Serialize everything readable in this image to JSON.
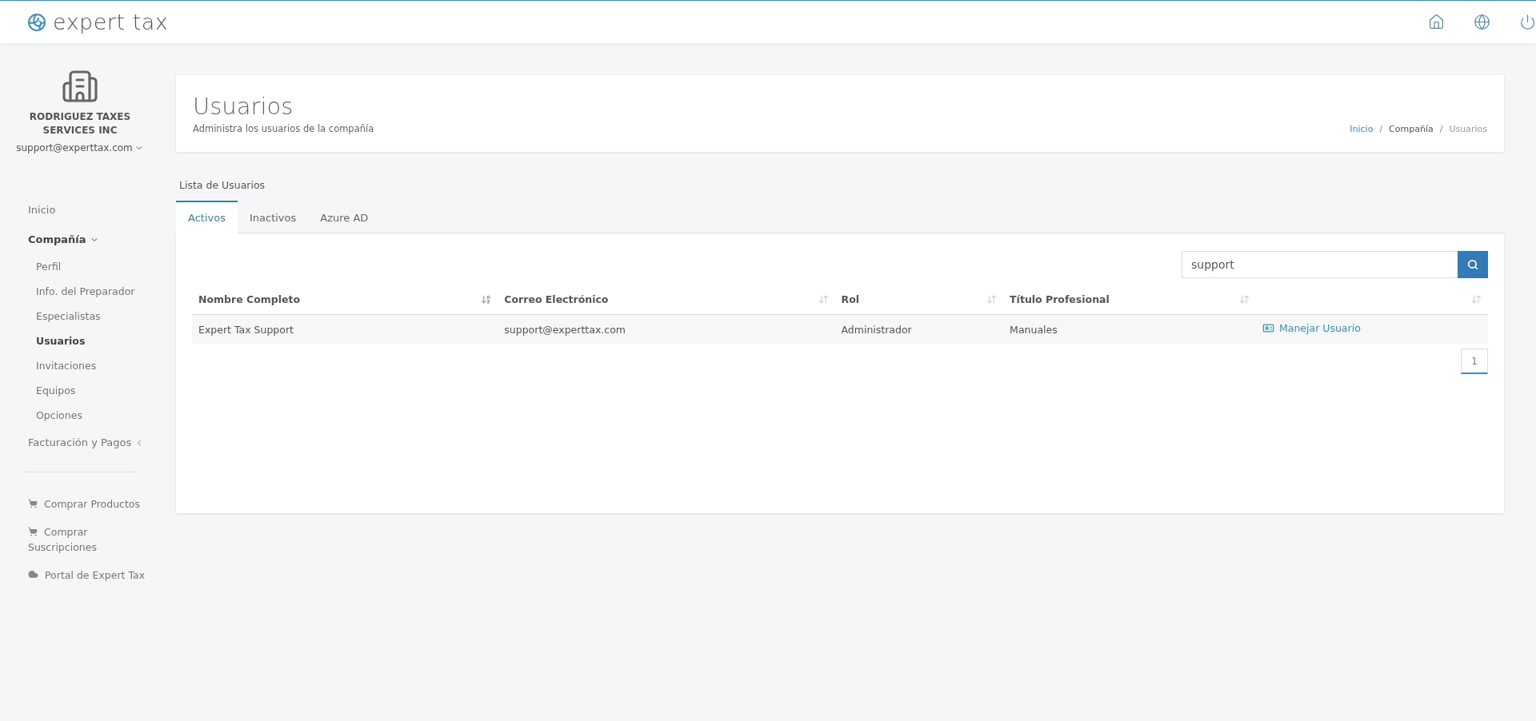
{
  "brand": {
    "name": "expert tax"
  },
  "company": {
    "name": "RODRIGUEZ TAXES SERVICES INC",
    "email": "support@experttax.com"
  },
  "sidebar": {
    "items": [
      {
        "kind": "link",
        "label": "Inicio",
        "selected": false
      },
      {
        "kind": "group",
        "label": "Compañía",
        "selected": false,
        "expanded": true,
        "children": [
          {
            "label": "Perfil",
            "selected": false
          },
          {
            "label": "Info. del Preparador",
            "selected": false
          },
          {
            "label": "Especialistas",
            "selected": false
          },
          {
            "label": "Usuarios",
            "selected": true
          },
          {
            "label": "Invitaciones",
            "selected": false
          },
          {
            "label": "Equipos",
            "selected": false
          },
          {
            "label": "Opciones",
            "selected": false
          }
        ]
      },
      {
        "kind": "group",
        "label": "Facturación y Pagos",
        "selected": false,
        "expanded": false
      }
    ],
    "links": [
      {
        "kind": "cart",
        "label": "Comprar Productos"
      },
      {
        "kind": "cart",
        "label": "Comprar Suscripciones"
      },
      {
        "kind": "cloud",
        "label": "Portal de Expert Tax"
      }
    ]
  },
  "page": {
    "title": "Usuarios",
    "subtitle": "Administra los usuarios de la compañía",
    "breadcrumb": [
      {
        "label": "Inicio",
        "kind": "link"
      },
      {
        "separator": "/",
        "label": "Compañía",
        "kind": "text"
      },
      {
        "separator": "/",
        "label": "Usuarios",
        "kind": "current"
      }
    ]
  },
  "list": {
    "title": "Lista de Usuarios",
    "tabs": [
      {
        "label": "Activos",
        "selected": true
      },
      {
        "label": "Inactivos",
        "selected": false
      },
      {
        "label": "Azure AD",
        "selected": false
      }
    ],
    "search": {
      "value": "support"
    },
    "table": {
      "columns": [
        {
          "label": "Nombre Completo",
          "sorted": true
        },
        {
          "label": "Correo Electrónico",
          "sorted": false
        },
        {
          "label": "Rol",
          "sorted": false
        },
        {
          "label": "Título Profesional",
          "sorted": false
        },
        {
          "sorted": false
        }
      ],
      "rows": [
        {
          "cells": [
            "Expert Tax Support",
            "support@experttax.com",
            "Administrador",
            "Manuales"
          ],
          "action": "Manejar Usuario"
        }
      ]
    },
    "pagination": [
      {
        "label": "1",
        "selected": true
      }
    ]
  }
}
